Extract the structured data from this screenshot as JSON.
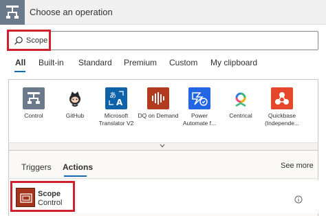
{
  "header": {
    "title": "Choose an operation",
    "icon": "control-icon"
  },
  "search": {
    "value": "Scope",
    "icon": "search-icon"
  },
  "category_tabs": [
    {
      "label": "All",
      "active": true
    },
    {
      "label": "Built-in",
      "active": false
    },
    {
      "label": "Standard",
      "active": false
    },
    {
      "label": "Premium",
      "active": false
    },
    {
      "label": "Custom",
      "active": false
    },
    {
      "label": "My clipboard",
      "active": false
    }
  ],
  "connectors": [
    {
      "label": "Control",
      "icon": "control-icon",
      "color": "#6b7a8a"
    },
    {
      "label": "GitHub",
      "icon": "github-icon",
      "color": "#ffffff"
    },
    {
      "label": "Microsoft Translator V2",
      "icon": "translator-icon",
      "color": "#0e62a8"
    },
    {
      "label": "DQ on Demand",
      "icon": "dq-icon",
      "color": "#b23a1e"
    },
    {
      "label": "Power Automate f...",
      "icon": "power-automate-icon",
      "color": "#2266e3"
    },
    {
      "label": "Centrical",
      "icon": "centrical-icon",
      "color": "#ffffff"
    },
    {
      "label": "Quickbase (Independe...",
      "icon": "quickbase-icon",
      "color": "#e6472a"
    }
  ],
  "sub_tabs": [
    {
      "label": "Triggers",
      "active": false
    },
    {
      "label": "Actions",
      "active": true
    }
  ],
  "see_more": "See more",
  "actions": [
    {
      "name": "Scope",
      "connector": "Control",
      "icon": "scope-icon",
      "color": "#a4351c"
    }
  ],
  "accent": "#0f6cbd",
  "highlight": "#d01f2d"
}
